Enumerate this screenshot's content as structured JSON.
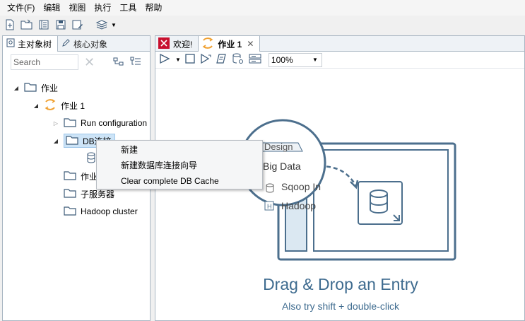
{
  "menu": [
    "文件(F)",
    "编辑",
    "视图",
    "执行",
    "工具",
    "帮助"
  ],
  "left_tabs": [
    {
      "label": "主对象树",
      "active": true
    },
    {
      "label": "核心对象",
      "active": false
    }
  ],
  "search": {
    "placeholder": "Search"
  },
  "tree": [
    {
      "label": "作业",
      "icon": "folder-icon",
      "expanded": true
    },
    {
      "label": "作业 1",
      "icon": "job-icon",
      "expanded": true
    },
    {
      "label": "Run configuration",
      "icon": "folder-icon",
      "expanded": false
    },
    {
      "label": "DB连接",
      "icon": "folder-icon",
      "expanded": true,
      "selected": true
    },
    {
      "label": "",
      "icon": "database-icon"
    },
    {
      "label": "作业",
      "icon": "folder-icon"
    },
    {
      "label": "子服务器",
      "icon": "folder-icon"
    },
    {
      "label": "Hadoop cluster",
      "icon": "folder-icon"
    }
  ],
  "right_tabs": [
    {
      "label": "欢迎!",
      "active": false
    },
    {
      "label": "作业 1",
      "active": true
    }
  ],
  "zoom": "100%",
  "canvas": {
    "design_tab": "Design",
    "items": [
      "Big Data",
      "Sqoop In",
      "Hadoop"
    ],
    "title": "Drag & Drop an Entry",
    "subtitle": "Also try shift + double-click"
  },
  "context_menu": [
    "新建",
    "新建数据库连接向导",
    "Clear complete DB Cache"
  ],
  "colors": {
    "accent": "#3e6b8f",
    "selection": "#cde4f7",
    "spoon_orange": "#f0a030"
  }
}
